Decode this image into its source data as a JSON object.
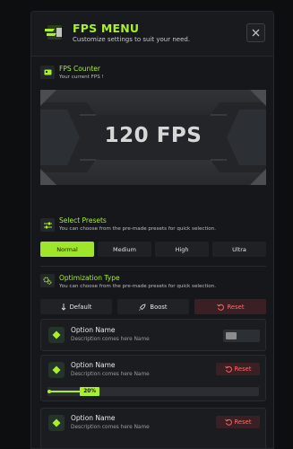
{
  "header": {
    "title": "FPS MENU",
    "subtitle": "Customize settings to suit your need."
  },
  "fps_counter": {
    "title": "FPS Counter",
    "subtitle": "Your current FPS !",
    "value": "120 FPS"
  },
  "presets": {
    "title": "Select Presets",
    "subtitle": "You can choose from the pre-made presets for quick selection.",
    "tabs": [
      "Normal",
      "Medium",
      "High",
      "Ultra"
    ],
    "active": "Normal"
  },
  "optimization": {
    "title": "Optimization Type",
    "subtitle": "You can choose from the pre-made presets for quick selection.",
    "buttons": [
      "Default",
      "Boost",
      "Reset"
    ]
  },
  "options": [
    {
      "name": "Option Name",
      "description": "Description comes here Name",
      "control": "toggle",
      "enabled": false
    },
    {
      "name": "Option Name",
      "description": "Description comes here Name",
      "control": "reset",
      "reset_label": "Reset",
      "slider_label": "20%",
      "slider_value": 0.2
    },
    {
      "name": "Option Name",
      "description": "Description comes here Name",
      "control": "reset",
      "reset_label": "Reset"
    }
  ],
  "colors": {
    "accent": "#a8f02a",
    "danger": "#ff6b6b",
    "panel": "#15171a"
  },
  "icons": {
    "logo": "fps-logo-icon",
    "close": "close-icon",
    "fps_counter": "monitor-icon",
    "presets": "sliders-icon",
    "optimization": "gears-icon",
    "option": "diamond-icon",
    "default": "arrow-down-icon",
    "boost": "rocket-icon",
    "reset": "undo-icon"
  }
}
